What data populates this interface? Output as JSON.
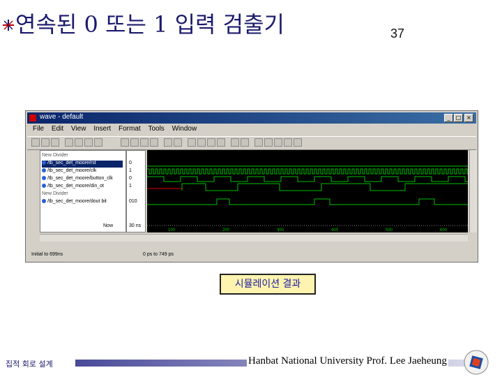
{
  "slide": {
    "title": "연속된 0 또는 1 입력 검출기",
    "page_number": "37",
    "caption": "시뮬레이션 결과",
    "footer_left": "집적 회로 설계",
    "footer_right": "Hanbat National University Prof. Lee Jaeheung"
  },
  "window": {
    "title": "wave - default",
    "menu": [
      "File",
      "Edit",
      "View",
      "Insert",
      "Format",
      "Tools",
      "Window"
    ],
    "signals": [
      {
        "label": "New Divider",
        "value": ""
      },
      {
        "label": "/tb_sec_det_moore/rst",
        "value": "0"
      },
      {
        "label": "/tb_sec_det_moore/clk",
        "value": "1"
      },
      {
        "label": "/tb_sec_det_moore/button_clk",
        "value": "0"
      },
      {
        "label": "/tb_sec_det_moore/din_ot",
        "value": "1"
      },
      {
        "label": "New Divider",
        "value": ""
      },
      {
        "label": "/tb_sec_det_moore/dout bit",
        "value": "010"
      }
    ],
    "now_label": "Now",
    "now_value": "30 ns",
    "axis_ticks": [
      "100",
      "200",
      "300",
      "400",
      "500",
      "600"
    ],
    "status_left": "Initial to 699ns",
    "status_mid": "0 ps to 749 ps"
  },
  "colors": {
    "title": "#1a1a6e",
    "wave_green": "#00c000",
    "wave_red": "#e00000",
    "caption_bg": "#fff3b0"
  }
}
